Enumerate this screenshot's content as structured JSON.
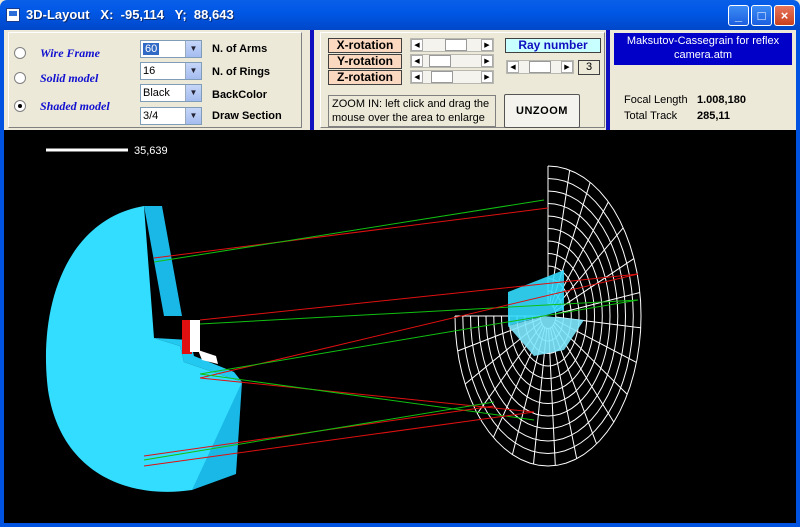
{
  "window": {
    "title": "3D-Layout",
    "x_label": "X:",
    "x_value": "-95,114",
    "y_label": "Y;",
    "y_value": "88,643",
    "minimize": "_",
    "maximize": "□",
    "close": "×"
  },
  "model": {
    "options": [
      {
        "label": "Wire Frame",
        "selected": false
      },
      {
        "label": "Solid model",
        "selected": false
      },
      {
        "label": "Shaded model",
        "selected": true
      }
    ]
  },
  "settings": [
    {
      "value": "60",
      "label": "N. of Arms"
    },
    {
      "value": "16",
      "label": "N. of Rings"
    },
    {
      "value": "Black",
      "label": "BackColor"
    },
    {
      "value": "3/4",
      "label": "Draw Section"
    }
  ],
  "rotation": {
    "x_label": "X-rotation",
    "y_label": "Y-rotation",
    "z_label": "Z-rotation"
  },
  "ray": {
    "label": "Ray number",
    "value": "3"
  },
  "zoom": {
    "hint": "ZOOM IN: left click and drag the mouse over the area to enlarge",
    "unzoom_label": "UNZOOM"
  },
  "file": {
    "name": "Maksutov-Cassegrain for reflex camera.atm"
  },
  "info": {
    "focal_label": "Focal Length",
    "focal_value": "1.008,180",
    "track_label": "Total Track",
    "track_value": "285,11"
  },
  "scale": {
    "value": "35,639"
  },
  "colors": {
    "lens_fill": "#33ddff",
    "lens_side": "#1ab8e6",
    "ray_red": "#e01010",
    "ray_green": "#10c010",
    "wire": "#ffffff",
    "viewport_bg": "#000000"
  }
}
